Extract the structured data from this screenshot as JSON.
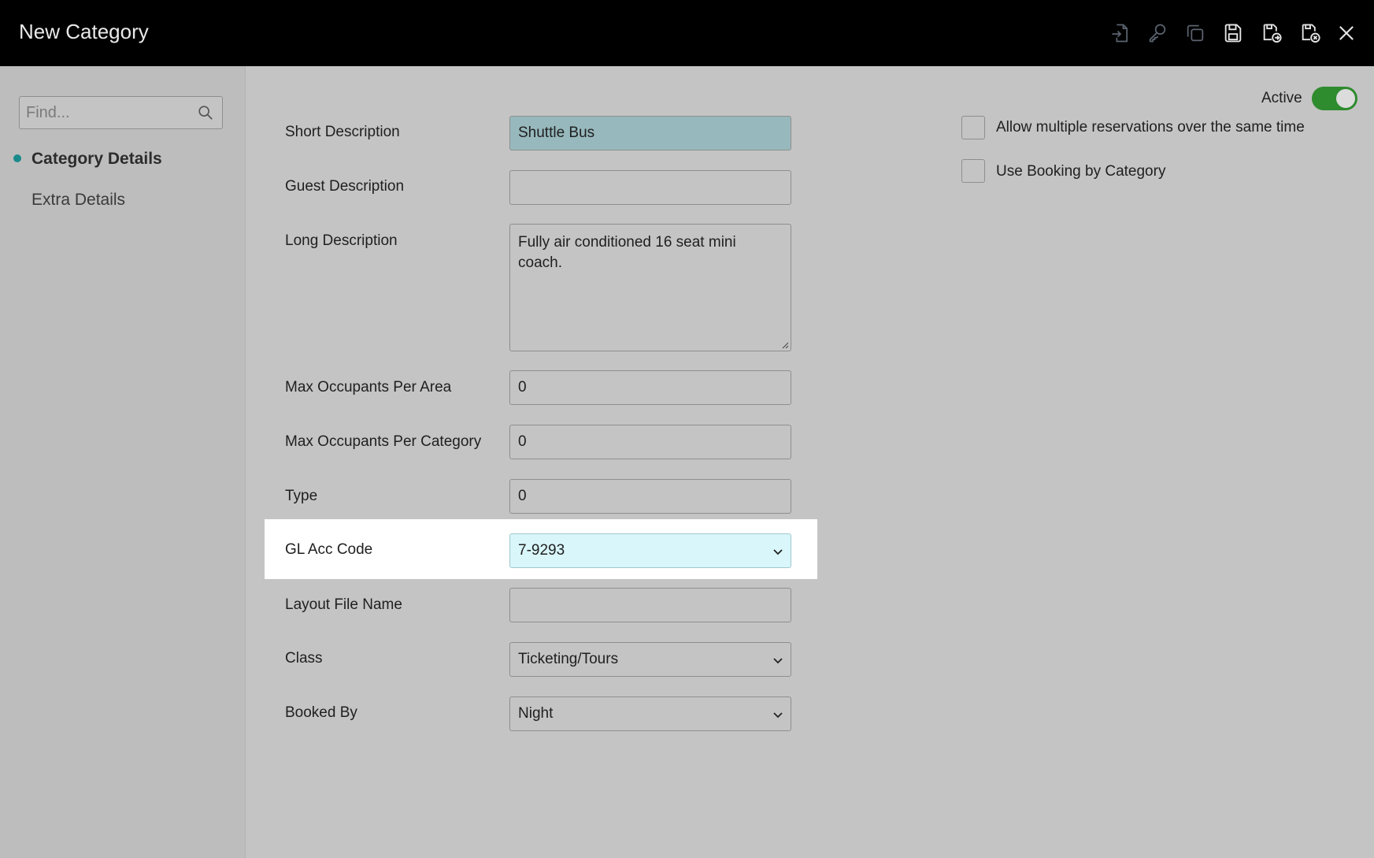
{
  "window": {
    "title": "New Category",
    "toolbar_icons": [
      "import-icon",
      "key-icon",
      "copy-icon",
      "save-icon",
      "save-and-next-icon",
      "save-and-close-icon",
      "close-icon"
    ]
  },
  "sidebar": {
    "search_placeholder": "Find...",
    "items": [
      {
        "label": "Category Details",
        "active": true
      },
      {
        "label": "Extra Details",
        "active": false
      }
    ]
  },
  "form": {
    "short_description": {
      "label": "Short Description",
      "value": "Shuttle Bus"
    },
    "guest_description": {
      "label": "Guest Description",
      "value": ""
    },
    "long_description": {
      "label": "Long Description",
      "value": "Fully air conditioned 16 seat mini coach."
    },
    "max_occupants_area": {
      "label": "Max Occupants Per Area",
      "value": "0"
    },
    "max_occupants_category": {
      "label": "Max Occupants Per Category",
      "value": "0"
    },
    "type": {
      "label": "Type",
      "value": "0"
    },
    "gl_acc_code": {
      "label": "GL Acc Code",
      "value": "7-9293"
    },
    "layout_file_name": {
      "label": "Layout File Name",
      "value": ""
    },
    "class": {
      "label": "Class",
      "value": "Ticketing/Tours"
    },
    "booked_by": {
      "label": "Booked By",
      "value": "Night"
    }
  },
  "options": {
    "active_label": "Active",
    "active_on": true,
    "allow_multiple": {
      "label": "Allow multiple reservations over the same time",
      "checked": false
    },
    "use_booking_by_category": {
      "label": "Use Booking by Category",
      "checked": false
    }
  },
  "colors": {
    "topbar": "#000000",
    "accent_teal": "#1a8a8c",
    "toggle_on": "#2e8b2e",
    "short_desc_fill": "#97b9bd",
    "gl_field_fill": "#d9f6fa"
  }
}
